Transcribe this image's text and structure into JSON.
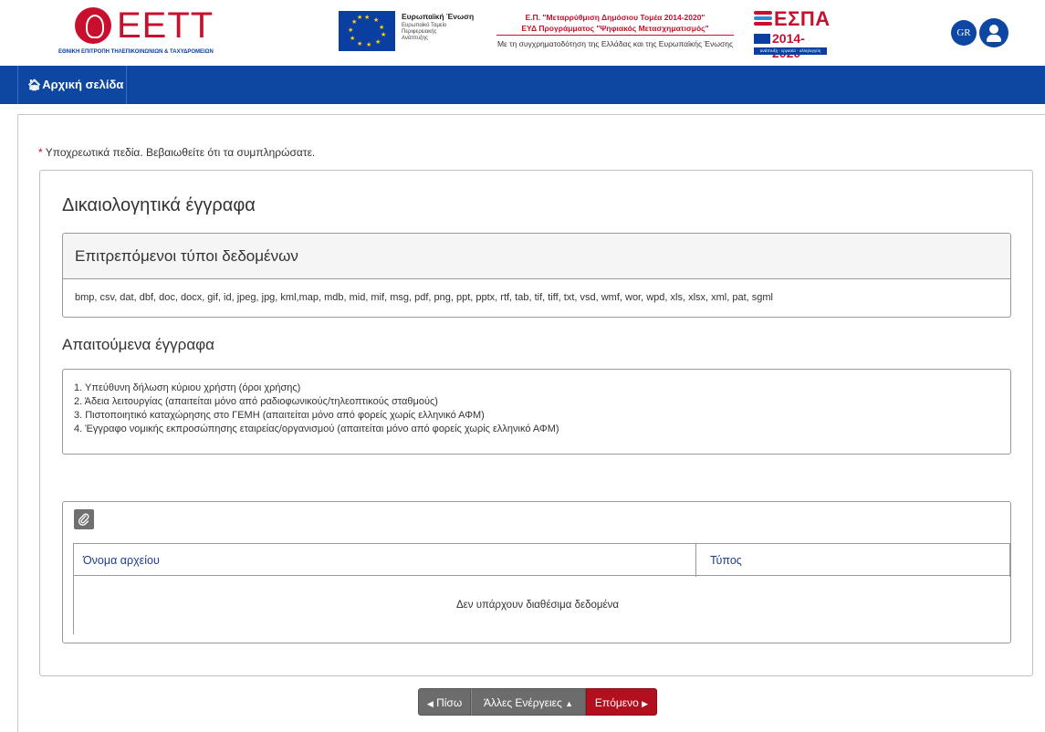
{
  "header": {
    "logo_text": "ΕΕΤΤ",
    "logo_subtitle": "ΕΘΝΙΚΗ ΕΠΙΤΡΟΠΗ ΤΗΛΕΠΙΚΟΙΝΩΝΙΩΝ & ΤΑΧΥΔΡΟΜΕΙΩΝ",
    "eu_title": "Ευρωπαϊκή Ένωση",
    "eu_subtitle": "Ευρωπαϊκό Ταμείο\nΠεριφερειακής\nΑνάπτυξης",
    "ep_line1": "Ε.Π. \"Μεταρρύθμιση Δημόσιου Τομέα 2014-2020\"",
    "ep_line2": "ΕΥΔ Προγράμματος \"Ψηφιακός Μετασχηματισμός\"",
    "ep_line3": "Με τη συγχρηματοδότηση της Ελλάδας και της Ευρωπαϊκής Ένωσης",
    "espa_title": "ΕΣΠΑ",
    "espa_years": "2014-2020",
    "espa_tagline": "ανάπτυξη - εργασία - αλληλεγγύη",
    "lang_label": "GR",
    "colors": {
      "brand_red": "#c8102e",
      "brand_blue": "#0d47a1"
    }
  },
  "nav": {
    "home_label": "Αρχική σελίδα",
    "home_icon": "home-icon"
  },
  "form": {
    "required_star": "*",
    "required_note": " Υποχρεωτικά πεδία. Βεβαιωθείτε ότι τα συμπληρώσατε.",
    "section_title": "Δικαιολογητικά έγγραφα",
    "allowed_types_title": "Επιτρεπόμενοι τύποι δεδομένων",
    "allowed_types": "bmp, csv, dat, dbf, doc, docx, gif, id, jpeg, jpg, kml,map, mdb, mid, mif, msg, pdf, png, ppt, pptx, rtf, tab, tif, tiff, txt, vsd, wmf, wor, wpd, xls, xlsx, xml, pat, sgml",
    "required_docs_title": "Απαιτούμενα έγγραφα",
    "required_docs": [
      "1. Υπεύθυνη δήλωση κύριου χρήστη (όροι χρήσης)",
      "2. Άδεια λειτουργίας (απαιτείται μόνο από ραδιοφωνικούς/τηλεοπτικούς σταθμούς)",
      "3. Πιστοποιητικό καταχώρησης στο ΓΕΜΗ (απαιτείται μόνο από φορείς χωρίς ελληνικό ΑΦΜ)",
      "4. Έγγραφο νομικής εκπροσώπησης εταιρείας/οργανισμού (απαιτείται μόνο από φορείς χωρίς ελληνικό ΑΦΜ)"
    ],
    "attach_icon": "paperclip-icon",
    "table": {
      "col_name": "Όνομα αρχείου",
      "col_type": "Τύπος",
      "empty_message": "Δεν υπάρχουν διαθέσιμα δεδομένα"
    }
  },
  "footer": {
    "back_label": "Πίσω",
    "more_label": "Άλλες Ενέργειες",
    "next_label": "Επόμενο"
  }
}
